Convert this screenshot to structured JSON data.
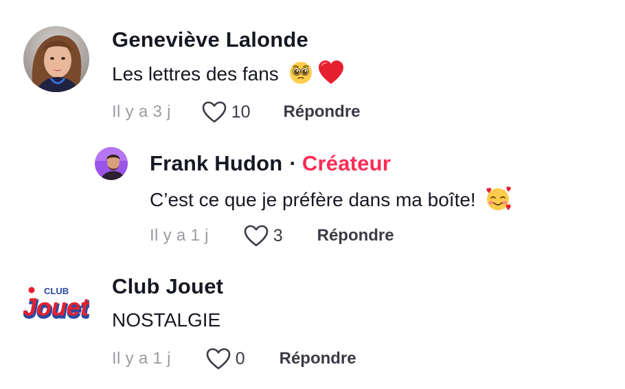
{
  "comments": [
    {
      "username": "Geneviève Lalonde",
      "text": "Les lettres des fans",
      "emojis": [
        "pleading-face-icon",
        "red-heart-icon"
      ],
      "time": "Il y a 3 j",
      "likes": "10",
      "reply_label": "Répondre"
    },
    {
      "username": "Frank Hudon",
      "creator_label": "Créateur",
      "separator": "·",
      "text": "C’est ce que je préfère dans ma boîte!",
      "emojis": [
        "smiling-face-with-hearts-icon"
      ],
      "time": "Il y a 1 j",
      "likes": "3",
      "reply_label": "Répondre"
    },
    {
      "username": "Club Jouet",
      "text": "NOSTALGIE",
      "logo_club": "CLUB",
      "logo_main": "Jouet",
      "time": "Il y a 1 j",
      "likes": "0",
      "reply_label": "Répondre"
    }
  ],
  "colors": {
    "accent": "#fe2c55",
    "text": "#161823",
    "muted": "#9a9ba1",
    "logo_red": "#e8202f",
    "logo_blue": "#2a4aa0"
  }
}
